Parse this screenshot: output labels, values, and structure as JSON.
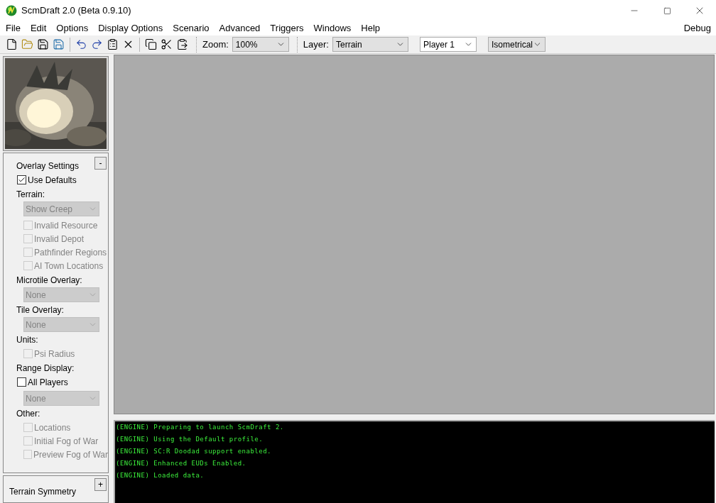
{
  "window": {
    "title": "ScmDraft 2.0 (Beta 0.9.10)"
  },
  "menu": [
    "File",
    "Edit",
    "Options",
    "Display Options",
    "Scenario",
    "Advanced",
    "Triggers",
    "Windows",
    "Help"
  ],
  "menu_right": "Debug",
  "toolbar": {
    "zoom_label": "Zoom:",
    "zoom": "100%",
    "layer_label": "Layer:",
    "layer": "Terrain",
    "player": "Player 1",
    "view": "Isometrical"
  },
  "overlay_panel": {
    "title": "Overlay Settings",
    "collapse": "-",
    "items": [
      {
        "kind": "checkbox",
        "label": "Use Defaults",
        "checked": true,
        "disabled": false
      },
      {
        "kind": "heading",
        "label": "Terrain:"
      },
      {
        "kind": "dropdown",
        "label": "Show Creep",
        "disabled": true
      },
      {
        "kind": "checkbox",
        "label": "Invalid Resource",
        "checked": false,
        "disabled": true
      },
      {
        "kind": "checkbox",
        "label": "Invalid Depot",
        "checked": false,
        "disabled": true
      },
      {
        "kind": "checkbox",
        "label": "Pathfinder Regions",
        "checked": false,
        "disabled": true
      },
      {
        "kind": "checkbox",
        "label": "AI Town Locations",
        "checked": false,
        "disabled": true
      },
      {
        "kind": "heading",
        "label": "Microtile Overlay:"
      },
      {
        "kind": "dropdown",
        "label": "None",
        "disabled": true
      },
      {
        "kind": "heading",
        "label": "Tile Overlay:"
      },
      {
        "kind": "dropdown",
        "label": "None",
        "disabled": true
      },
      {
        "kind": "heading",
        "label": "Units:"
      },
      {
        "kind": "checkbox",
        "label": "Psi Radius",
        "checked": false,
        "disabled": true
      },
      {
        "kind": "heading",
        "label": "Range Display:"
      },
      {
        "kind": "checkbox",
        "label": "All Players",
        "checked": false,
        "disabled": false
      },
      {
        "kind": "dropdown",
        "label": "None",
        "disabled": true
      },
      {
        "kind": "heading",
        "label": "Other:"
      },
      {
        "kind": "checkbox",
        "label": "Locations",
        "checked": false,
        "disabled": true
      },
      {
        "kind": "checkbox",
        "label": "Initial Fog of War",
        "checked": false,
        "disabled": true
      },
      {
        "kind": "checkbox",
        "label": "Preview Fog of War",
        "checked": false,
        "disabled": true
      }
    ]
  },
  "symmetry_panel": {
    "title": "Terrain Symmetry",
    "expand": "+"
  },
  "console": [
    "(ENGINE) Preparing to launch ScmDraft 2.",
    "(ENGINE) Using the Default profile.",
    "(ENGINE) SC:R Doodad support enabled.",
    "(ENGINE) Enhanced EUDs Enabled.",
    "(ENGINE) Loaded data."
  ]
}
